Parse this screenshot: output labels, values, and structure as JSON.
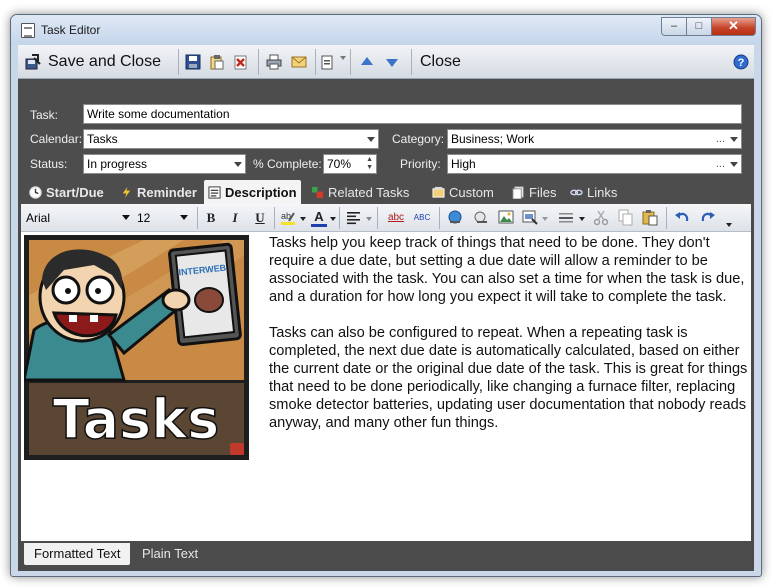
{
  "window": {
    "title": "Task Editor",
    "min_label": "–",
    "max_label": "□",
    "close_label": "✕"
  },
  "toolbar": {
    "save_close_label": "Save and Close",
    "close_label": "Close",
    "icons": [
      "save-close-icon",
      "save-icon",
      "copy-icon",
      "delete-icon",
      "print-icon",
      "email-icon",
      "paste-special-icon",
      "up-arrow-icon",
      "down-arrow-icon",
      "help-icon"
    ]
  },
  "form": {
    "task_label": "Task:",
    "task_value": "Write some documentation",
    "calendar_label": "Calendar:",
    "calendar_value": "Tasks",
    "category_label": "Category:",
    "category_value": "Business; Work",
    "status_label": "Status:",
    "status_value": "In progress",
    "percent_label": "% Complete:",
    "percent_value": "70%",
    "priority_label": "Priority:",
    "priority_value": "High",
    "ellipsis": "..."
  },
  "tabs": [
    {
      "label": "Start/Due",
      "icon": "clock-icon"
    },
    {
      "label": "Reminder",
      "icon": "lightning-icon"
    },
    {
      "label": "Description",
      "icon": "document-icon"
    },
    {
      "label": "Related Tasks",
      "icon": "related-tasks-icon"
    },
    {
      "label": "Custom",
      "icon": "custom-icon"
    },
    {
      "label": "Files",
      "icon": "files-icon"
    },
    {
      "label": "Links",
      "icon": "link-icon"
    }
  ],
  "format_toolbar": {
    "font": "Arial",
    "size": "12",
    "bold": "B",
    "italic": "I",
    "underline": "U",
    "font_color": "A",
    "spell": "abc",
    "spell2": "ABC"
  },
  "image": {
    "badge": "INTERWEB",
    "caption": "Tasks"
  },
  "description": {
    "paragraph1": "Tasks help you keep track of things that need to be done. They don't require a due date, but setting a due date will allow a reminder to be associated with the task. You can also set a time for when the task is due, and a duration for how long you expect it will take to complete the task.",
    "paragraph2": "Tasks can also be configured to repeat. When a repeating task is completed, the next due date is automatically calculated, based on either the current date or the original due date of the task. This is great for things that need to be done periodically, like changing a furnace filter, replacing smoke detector batteries, updating user documentation that nobody reads anyway, and many other fun things."
  },
  "bottom_tabs": {
    "formatted": "Formatted Text",
    "plain": "Plain Text"
  },
  "colors": {
    "dark_panel": "#4d4d4d",
    "titlebar": "#c9d7e8",
    "close_red": "#c44127"
  }
}
